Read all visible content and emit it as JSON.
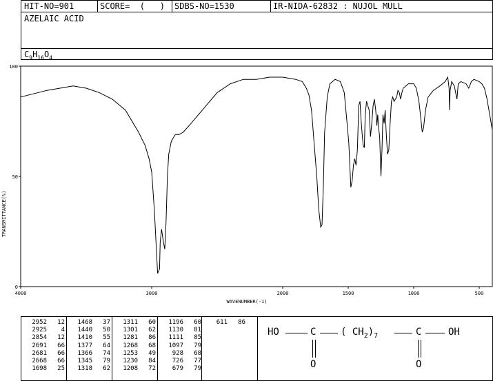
{
  "header": {
    "hit_no": "HIT-NO=901",
    "score": "SCORE=  (   )",
    "sdbs_no": "SDBS-NO=1530",
    "ir_nida": "IR-NIDA-62832 : NUJOL MULL"
  },
  "compound_name": "AZELAIC ACID",
  "formula": {
    "c": "C",
    "c_n": "9",
    "h": "H",
    "h_n": "16",
    "o": "O",
    "o_n": "4"
  },
  "chart_data": {
    "type": "line",
    "xlabel": "WAVENUMBER(-1)",
    "ylabel": "TRANSMITTANCE(%)",
    "xlim": [
      4000,
      400
    ],
    "ylim": [
      0,
      100
    ],
    "x_ticks": [
      "4000",
      "3000",
      "2000",
      "1500",
      "1000",
      "500"
    ],
    "x_tick_values": [
      4000,
      3000,
      2000,
      1500,
      1000,
      500
    ],
    "y_ticks": [
      "0",
      "50",
      "100"
    ],
    "y_tick_values": [
      0,
      50,
      100
    ],
    "series": [
      {
        "points": [
          [
            4000,
            86
          ],
          [
            3800,
            89
          ],
          [
            3600,
            91
          ],
          [
            3500,
            90
          ],
          [
            3400,
            88
          ],
          [
            3300,
            85
          ],
          [
            3200,
            80
          ],
          [
            3100,
            70
          ],
          [
            3050,
            64
          ],
          [
            3020,
            58
          ],
          [
            3000,
            52
          ],
          [
            2980,
            35
          ],
          [
            2960,
            12
          ],
          [
            2955,
            6
          ],
          [
            2940,
            8
          ],
          [
            2935,
            20
          ],
          [
            2925,
            26
          ],
          [
            2910,
            20
          ],
          [
            2900,
            17
          ],
          [
            2890,
            30
          ],
          [
            2880,
            50
          ],
          [
            2870,
            60
          ],
          [
            2850,
            66
          ],
          [
            2820,
            69
          ],
          [
            2790,
            69
          ],
          [
            2760,
            70
          ],
          [
            2700,
            74
          ],
          [
            2600,
            81
          ],
          [
            2500,
            88
          ],
          [
            2400,
            92
          ],
          [
            2300,
            94
          ],
          [
            2200,
            94
          ],
          [
            2100,
            95
          ],
          [
            2000,
            95
          ],
          [
            1900,
            94
          ],
          [
            1850,
            93
          ],
          [
            1820,
            90
          ],
          [
            1800,
            87
          ],
          [
            1780,
            80
          ],
          [
            1760,
            65
          ],
          [
            1740,
            50
          ],
          [
            1725,
            35
          ],
          [
            1710,
            27
          ],
          [
            1700,
            28
          ],
          [
            1690,
            45
          ],
          [
            1680,
            70
          ],
          [
            1660,
            86
          ],
          [
            1640,
            92
          ],
          [
            1600,
            94
          ],
          [
            1560,
            93
          ],
          [
            1530,
            88
          ],
          [
            1510,
            75
          ],
          [
            1495,
            65
          ],
          [
            1480,
            45
          ],
          [
            1470,
            48
          ],
          [
            1460,
            55
          ],
          [
            1450,
            58
          ],
          [
            1440,
            55
          ],
          [
            1430,
            62
          ],
          [
            1425,
            72
          ],
          [
            1420,
            82
          ],
          [
            1410,
            84
          ],
          [
            1400,
            74
          ],
          [
            1395,
            70
          ],
          [
            1385,
            64
          ],
          [
            1377,
            63
          ],
          [
            1370,
            78
          ],
          [
            1360,
            84
          ],
          [
            1350,
            82
          ],
          [
            1340,
            80
          ],
          [
            1330,
            68
          ],
          [
            1320,
            74
          ],
          [
            1310,
            82
          ],
          [
            1300,
            85
          ],
          [
            1290,
            80
          ],
          [
            1281,
            73
          ],
          [
            1275,
            78
          ],
          [
            1268,
            72
          ],
          [
            1260,
            68
          ],
          [
            1250,
            50
          ],
          [
            1242,
            62
          ],
          [
            1235,
            78
          ],
          [
            1226,
            74
          ],
          [
            1218,
            80
          ],
          [
            1210,
            70
          ],
          [
            1200,
            60
          ],
          [
            1190,
            62
          ],
          [
            1180,
            74
          ],
          [
            1170,
            84
          ],
          [
            1160,
            86
          ],
          [
            1150,
            84
          ],
          [
            1130,
            86
          ],
          [
            1120,
            89
          ],
          [
            1110,
            88
          ],
          [
            1100,
            85
          ],
          [
            1090,
            88
          ],
          [
            1080,
            90
          ],
          [
            1060,
            91
          ],
          [
            1040,
            92
          ],
          [
            1000,
            92
          ],
          [
            980,
            90
          ],
          [
            960,
            84
          ],
          [
            945,
            76
          ],
          [
            935,
            70
          ],
          [
            925,
            72
          ],
          [
            910,
            80
          ],
          [
            890,
            86
          ],
          [
            850,
            89
          ],
          [
            800,
            91
          ],
          [
            780,
            92
          ],
          [
            760,
            93
          ],
          [
            740,
            95
          ],
          [
            730,
            90
          ],
          [
            726,
            80
          ],
          [
            722,
            89
          ],
          [
            710,
            93
          ],
          [
            690,
            91
          ],
          [
            680,
            88
          ],
          [
            670,
            85
          ],
          [
            660,
            92
          ],
          [
            640,
            93
          ],
          [
            600,
            92
          ],
          [
            580,
            90
          ],
          [
            560,
            93
          ],
          [
            540,
            94
          ],
          [
            500,
            93
          ],
          [
            480,
            92
          ],
          [
            460,
            90
          ],
          [
            440,
            85
          ],
          [
            420,
            78
          ],
          [
            400,
            71
          ]
        ]
      }
    ]
  },
  "peak_table": [
    [
      [
        "2952",
        "12"
      ],
      [
        "2925",
        "4"
      ],
      [
        "2854",
        "12"
      ],
      [
        "2691",
        "66"
      ],
      [
        "2681",
        "66"
      ],
      [
        "2668",
        "66"
      ],
      [
        "1698",
        "25"
      ]
    ],
    [
      [
        "1468",
        "37"
      ],
      [
        "1440",
        "50"
      ],
      [
        "1410",
        "55"
      ],
      [
        "1377",
        "64"
      ],
      [
        "1366",
        "74"
      ],
      [
        "1345",
        "79"
      ],
      [
        "1318",
        "62"
      ]
    ],
    [
      [
        "1311",
        "60"
      ],
      [
        "1301",
        "62"
      ],
      [
        "1281",
        "86"
      ],
      [
        "1268",
        "68"
      ],
      [
        "1253",
        "49"
      ],
      [
        "1230",
        "84"
      ],
      [
        "1208",
        "72"
      ]
    ],
    [
      [
        "1196",
        "60"
      ],
      [
        "1130",
        "81"
      ],
      [
        "1111",
        "85"
      ],
      [
        "1097",
        "79"
      ],
      [
        "928",
        "68"
      ],
      [
        "726",
        "77"
      ],
      [
        "679",
        "79"
      ]
    ],
    [
      [
        "611",
        "86"
      ]
    ]
  ],
  "structure": {
    "ho": "HO",
    "c1": "C",
    "ch2": "( CH",
    "sub2": "2",
    "close": ")",
    "sub7": "7",
    "c2": "C",
    "oh": "OH",
    "o1": "O",
    "o2": "O"
  }
}
